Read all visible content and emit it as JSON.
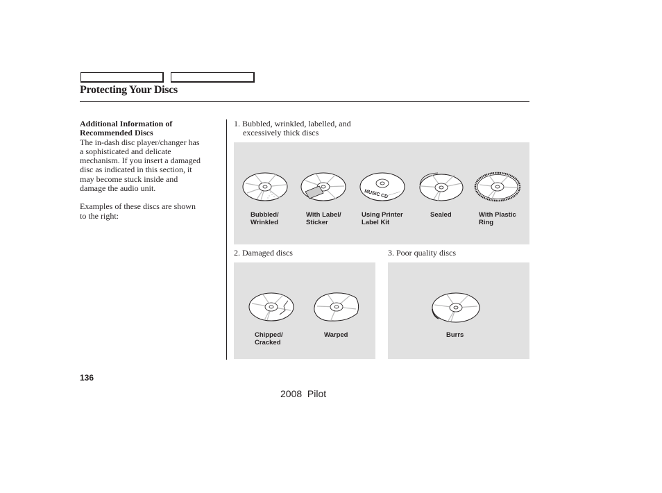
{
  "header": {
    "tabs": [
      "",
      ""
    ],
    "title": "Protecting Your Discs"
  },
  "sidebar": {
    "heading_line1": "Additional Information of",
    "heading_line2": "Recommended Discs",
    "body_lines": [
      "The in-dash disc player/changer has",
      "a sophisticated and delicate",
      "mechanism. If you insert a damaged",
      "disc as indicated in this section, it",
      "may become stuck inside and",
      "damage the audio unit."
    ],
    "examples_lines": [
      "Examples of these discs are shown",
      "to the right:"
    ]
  },
  "sections": [
    {
      "caption_line1": "1. Bubbled, wrinkled, labelled, and",
      "caption_line2": "excessively thick discs",
      "discs": [
        {
          "icon": "bubbled-disc-icon",
          "label_line1": "Bubbled/",
          "label_line2": "Wrinkled"
        },
        {
          "icon": "labeled-disc-icon",
          "label_line1": "With Label/",
          "label_line2": "Sticker"
        },
        {
          "icon": "printed-label-disc-icon",
          "label_line1": "Using Printer",
          "label_line2": "Label Kit",
          "disc_text": "MUSIC CD"
        },
        {
          "icon": "sealed-disc-icon",
          "label_line1": "Sealed",
          "label_line2": ""
        },
        {
          "icon": "plastic-ring-disc-icon",
          "label_line1": "With Plastic",
          "label_line2": "Ring"
        }
      ]
    },
    {
      "caption_line1": "2. Damaged discs",
      "discs": [
        {
          "icon": "cracked-disc-icon",
          "label_line1": "Chipped/",
          "label_line2": "Cracked"
        },
        {
          "icon": "warped-disc-icon",
          "label_line1": "Warped",
          "label_line2": ""
        }
      ]
    },
    {
      "caption_line1": "3. Poor quality discs",
      "discs": [
        {
          "icon": "burred-disc-icon",
          "label_line1": "Burrs",
          "label_line2": ""
        }
      ]
    }
  ],
  "footer": {
    "page_number": "136",
    "model": "2008  Pilot"
  },
  "colors": {
    "text": "#231f20",
    "panel": "#e1e1e1"
  }
}
